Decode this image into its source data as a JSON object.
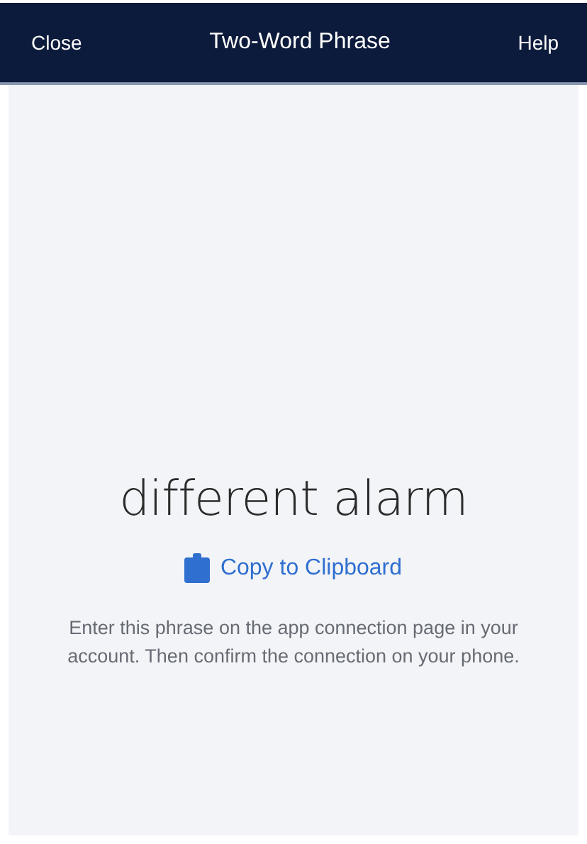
{
  "header": {
    "left_action": "Close",
    "title": "Two-Word Phrase",
    "right_action": "Help"
  },
  "phrase": "different alarm",
  "copy_link": "Copy to Clipboard",
  "instructions": "Enter this phrase on the app connection page in your account. Then confirm the connection on your phone."
}
